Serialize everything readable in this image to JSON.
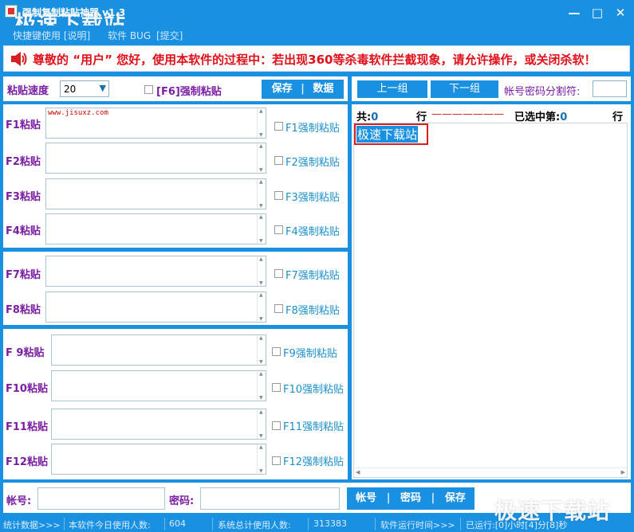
{
  "window": {
    "title": "强制复制粘贴神器 v1.3",
    "watermark": "极速下载站",
    "minimize_glyph": "—",
    "maximize_glyph": "□",
    "close_glyph": "✕"
  },
  "menu": {
    "items": [
      "快捷键使用 [说明]",
      "软件 BUG",
      "[提交]"
    ]
  },
  "notice": {
    "text": "尊敬的 “用户” 您好，使用本软件的过程中：若出现360等杀毒软件拦截现象，请允许操作，或关闭杀软！"
  },
  "speed": {
    "label": "粘贴速度",
    "value": "20"
  },
  "force_f6": {
    "label": "[F6]强制粘贴"
  },
  "top_buttons": {
    "save": "保存",
    "sep": "|",
    "data": "数据"
  },
  "group_buttons": {
    "prev": "上一组",
    "next": "下一组"
  },
  "separator": {
    "label": "帐号密码分割符:",
    "value": ""
  },
  "rows": [
    {
      "label": "F1粘贴",
      "value": "www.jisuxz.com",
      "force": "F1强制粘贴"
    },
    {
      "label": "F2粘贴",
      "value": "",
      "force": "F2强制粘贴"
    },
    {
      "label": "F3粘贴",
      "value": "",
      "force": "F3强制粘贴"
    },
    {
      "label": "F4粘贴",
      "value": "",
      "force": "F4强制粘贴"
    },
    {
      "label": "F7粘贴",
      "value": "",
      "force": "F7强制粘贴"
    },
    {
      "label": "F8粘贴",
      "value": "",
      "force": "F8强制粘贴"
    },
    {
      "label": "F 9粘贴",
      "value": "",
      "force": "F9强制粘贴"
    },
    {
      "label": "F10粘贴",
      "value": "",
      "force": "F10强制粘贴"
    },
    {
      "label": "F11粘贴",
      "value": "",
      "force": "F11强制粘贴"
    },
    {
      "label": "F12粘贴",
      "value": "",
      "force": "F12强制粘贴"
    }
  ],
  "stats": {
    "total_prefix": "共:",
    "total": "0",
    "row_unit": "行",
    "dashes": "———————",
    "selected_prefix": "已选中第:",
    "selected": "0",
    "selected_unit": "行"
  },
  "list": {
    "items": [
      "极速下载站"
    ]
  },
  "account": {
    "label": "帐号:",
    "value": ""
  },
  "password": {
    "label": "密码:",
    "value": ""
  },
  "bottom_buttons": {
    "account": "帐号",
    "password": "密码",
    "save": "保存",
    "sep": "|"
  },
  "status": {
    "stats_label": "统计数据>>>",
    "today_label": "本软件今日使用人数:",
    "today_value": "604",
    "total_label": "系统总计使用人数:",
    "total_value": "313383",
    "runtime_label": "软件运行时间>>>",
    "runtime_value": "已运行:[0]小时[4]分[8]秒"
  },
  "colors": {
    "accent": "#1a90e0",
    "label": "#7a1fa2",
    "notice": "#e0101a",
    "checkbox_text": "#1a8fc8"
  }
}
